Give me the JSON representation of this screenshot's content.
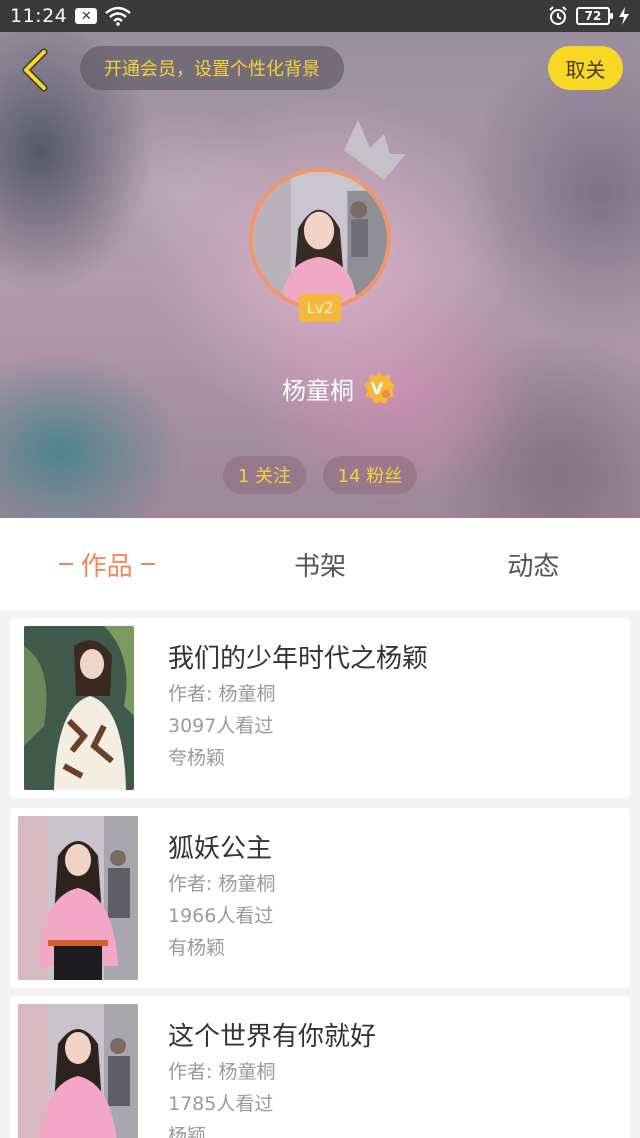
{
  "status_bar": {
    "time": "11:24",
    "battery": "72"
  },
  "header": {
    "vip_banner": "开通会员，设置个性化背景",
    "unfollow_label": "取关",
    "level": "Lv2",
    "username": "杨童桐",
    "following": "1 关注",
    "fans": "14 粉丝"
  },
  "tabs": [
    {
      "label": "作品",
      "active": true
    },
    {
      "label": "书架",
      "active": false
    },
    {
      "label": "动态",
      "active": false
    }
  ],
  "works": [
    {
      "title": "我们的少年时代之杨颖",
      "author": "作者: 杨童桐",
      "views": "3097人看过",
      "desc": "夸杨颖"
    },
    {
      "title": "狐妖公主",
      "author": "作者: 杨童桐",
      "views": "1966人看过",
      "desc": "有杨颖"
    },
    {
      "title": "这个世界有你就好",
      "author": "作者: 杨童桐",
      "views": "1785人看过",
      "desc": "杨颖"
    }
  ],
  "colors": {
    "accent": "#f0865a",
    "yellow": "#f8d824",
    "gold_text": "#f7d23a"
  }
}
